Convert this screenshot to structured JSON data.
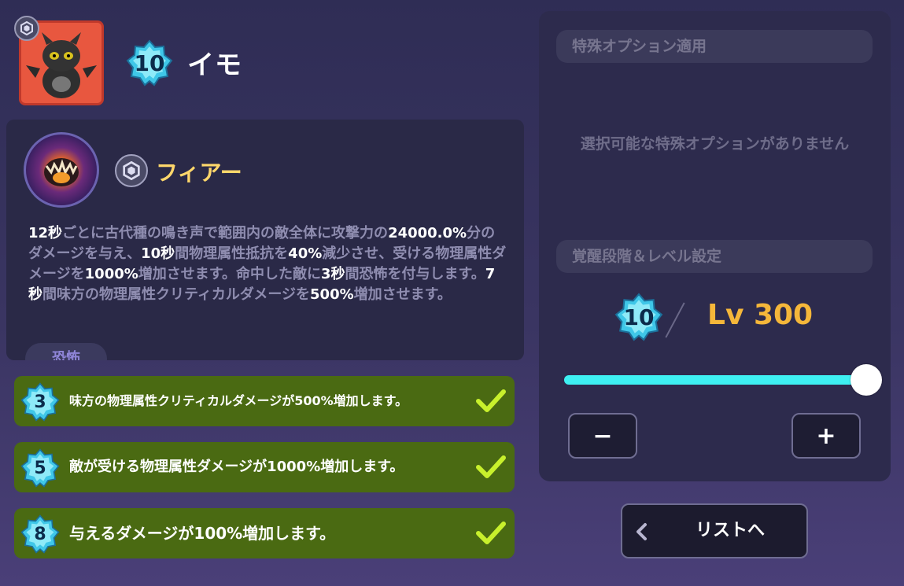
{
  "character": {
    "name": "イモ",
    "awakening": "10"
  },
  "skill": {
    "name": "フィアー",
    "description_parts": [
      {
        "t": "12秒",
        "h": true
      },
      {
        "t": "ごとに古代種の鳴き声で範囲内の敵全体に攻撃力の",
        "h": false
      },
      {
        "t": "24000.0%",
        "h": true
      },
      {
        "t": "分のダメージを与え、",
        "h": false
      },
      {
        "t": "10秒",
        "h": true
      },
      {
        "t": "間物理属性抵抗を",
        "h": false
      },
      {
        "t": "40%",
        "h": true
      },
      {
        "t": "減少させ、受ける物理属性ダメージを",
        "h": false
      },
      {
        "t": "1000%",
        "h": true
      },
      {
        "t": "増加させます。命中した敵に",
        "h": false
      },
      {
        "t": "3秒",
        "h": true
      },
      {
        "t": "間恐怖を付与します。",
        "h": false
      },
      {
        "t": "7秒",
        "h": true
      },
      {
        "t": "間味方の物理属性クリティカルダメージを",
        "h": false
      },
      {
        "t": "500%",
        "h": true
      },
      {
        "t": "増加させます。",
        "h": false
      }
    ],
    "tag": "恐怖"
  },
  "effects": [
    {
      "rank": "3",
      "text": "味方の物理属性クリティカルダメージが500%増加します。"
    },
    {
      "rank": "5",
      "text": "敵が受ける物理属性ダメージが1000%増加します。"
    },
    {
      "rank": "8",
      "text": "与えるダメージが100%増加します。"
    }
  ],
  "settings": {
    "special_header": "特殊オプション適用",
    "special_empty": "選択可能な特殊オプションがありません",
    "level_header": "覚醒段階＆レベル設定",
    "awakening": "10",
    "level_text": "Lv 300",
    "slider_fraction": 1.0,
    "minus_label": "−",
    "plus_label": "+"
  },
  "list_button": {
    "label": "リストへ"
  },
  "colors": {
    "accent_cyan": "#3ef0f2",
    "level_gold": "#f5b73a",
    "skill_gold": "#ffd76b",
    "effect_green": "#4a6a12",
    "check_yellow": "#c8f02c"
  },
  "icons": {
    "rank": "rank-emblem-icon",
    "check": "check-icon",
    "back": "chevron-left-icon",
    "star": "star-badge-icon"
  }
}
